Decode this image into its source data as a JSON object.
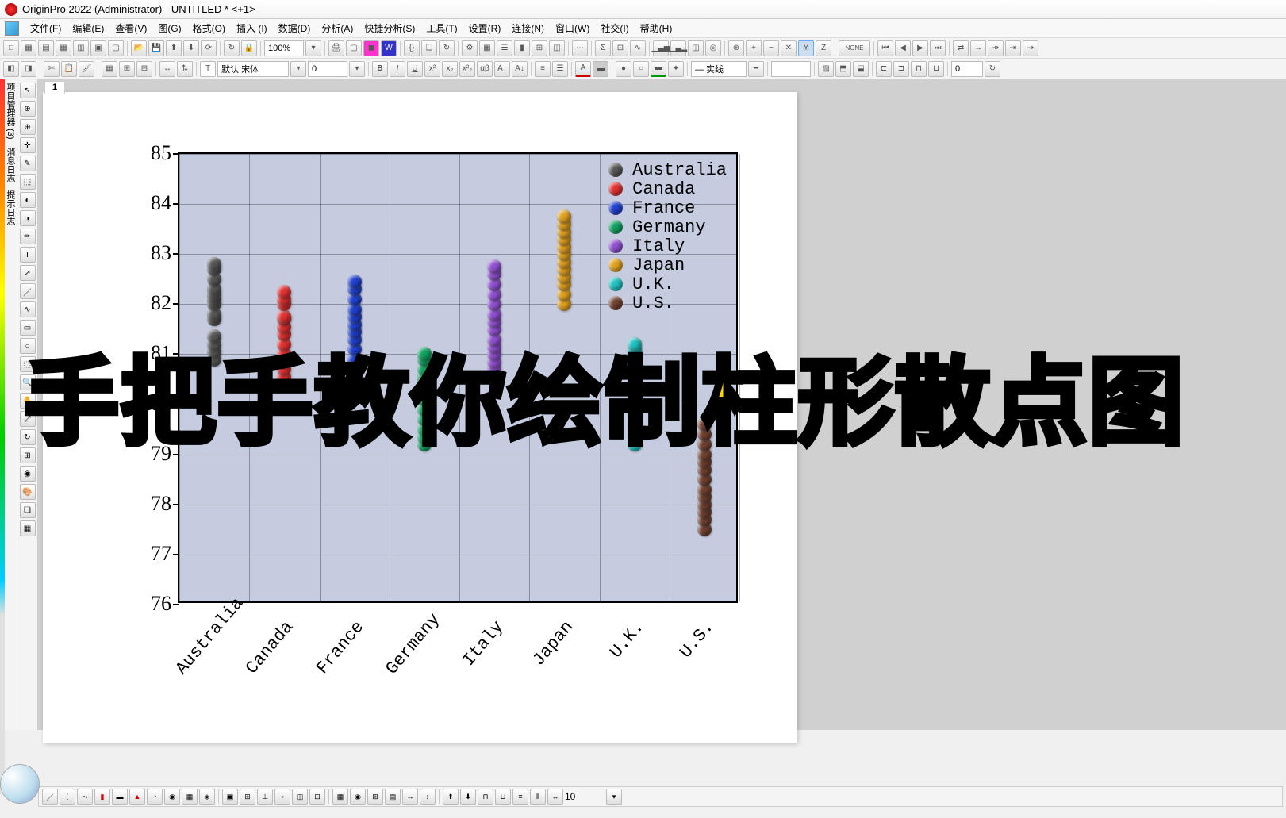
{
  "app": {
    "title": "OriginPro 2022 (Administrator) - UNTITLED * <+1>"
  },
  "menu": [
    "文件(F)",
    "编辑(E)",
    "查看(V)",
    "图(G)",
    "格式(O)",
    "插入 (I)",
    "数据(D)",
    "分析(A)",
    "快捷分析(S)",
    "工具(T)",
    "设置(R)",
    "连接(N)",
    "窗口(W)",
    "社交(I)",
    "帮助(H)"
  ],
  "toolbar1": {
    "zoom": "100%"
  },
  "toolbar2": {
    "font_prefix": "默认:",
    "font": "宋体",
    "size": "0",
    "angle": "0"
  },
  "tab_label": "1",
  "sidebar_labels": [
    "项目管理器 (3)",
    "消息日志",
    "提示日志"
  ],
  "overlay_text": "手把手教你绘制柱形散点图",
  "bottombar": {
    "value": "10"
  },
  "chart_data": {
    "type": "scatter",
    "ylim": [
      76,
      85
    ],
    "yticks": [
      76,
      77,
      78,
      79,
      80,
      81,
      82,
      83,
      84,
      85
    ],
    "categories": [
      "Australia",
      "Canada",
      "France",
      "Germany",
      "Italy",
      "Japan",
      "U.K.",
      "U.S."
    ],
    "colors": {
      "Australia": "#555555",
      "Canada": "#e03030",
      "France": "#2040d0",
      "Germany": "#10a060",
      "Italy": "#9050d0",
      "Japan": "#e0a020",
      "U.K.": "#20c0c0",
      "U.S.": "#704030"
    },
    "series": [
      {
        "name": "Australia",
        "values": [
          80.9,
          81.05,
          81.2,
          81.35,
          81.7,
          81.8,
          82.0,
          82.1,
          82.2,
          82.3,
          82.5,
          82.7,
          82.8
        ]
      },
      {
        "name": "Canada",
        "values": [
          80.4,
          80.55,
          80.7,
          80.85,
          81.0,
          81.2,
          81.4,
          81.55,
          81.7,
          81.75,
          82.0,
          82.1,
          82.25
        ]
      },
      {
        "name": "France",
        "values": [
          80.4,
          80.6,
          80.75,
          80.9,
          81.1,
          81.3,
          81.45,
          81.6,
          81.75,
          81.9,
          82.1,
          82.3,
          82.45
        ]
      },
      {
        "name": "Germany",
        "values": [
          79.2,
          79.35,
          79.5,
          79.7,
          79.9,
          80.1,
          80.3,
          80.5,
          80.55,
          80.7,
          80.9,
          81.0
        ]
      },
      {
        "name": "Italy",
        "values": [
          80.7,
          80.85,
          81.0,
          81.15,
          81.3,
          81.5,
          81.65,
          81.8,
          82.0,
          82.2,
          82.4,
          82.6,
          82.75
        ]
      },
      {
        "name": "Japan",
        "values": [
          82.0,
          82.2,
          82.4,
          82.55,
          82.7,
          82.85,
          83.0,
          83.15,
          83.3,
          83.45,
          83.6,
          83.75
        ]
      },
      {
        "name": "U.K.",
        "values": [
          79.2,
          79.4,
          79.6,
          79.8,
          80.0,
          80.2,
          80.4,
          80.6,
          80.8,
          81.0,
          81.1,
          81.2
        ]
      },
      {
        "name": "U.S.",
        "values": [
          77.5,
          77.7,
          77.85,
          78.0,
          78.15,
          78.3,
          78.5,
          78.7,
          78.85,
          79.0,
          79.2,
          79.4,
          79.6
        ]
      }
    ]
  }
}
